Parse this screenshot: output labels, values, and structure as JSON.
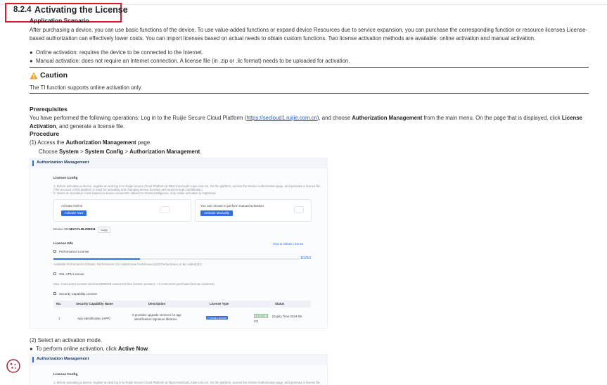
{
  "section": {
    "number": "8.2.4",
    "title": "Activating the License"
  },
  "scenario": {
    "heading": "Application Scenario",
    "paragraph": "After purchasing a device, you can use basic functions of the device. To use value-added functions or expand device Resources due to service expansion, you can purchase the corresponding function or resource licenses License-based authorization can effectively lower costs. You can import licenses based on actual needs to obtain custom functions. Two license activation methods are available: online activation and manual activation.",
    "bullets": [
      "Online activation: requires the device to be connected to the Internet.",
      "Manual activation: does not require an Internet connection. A license file (in .zip or .lic format) needs to be uploaded for activation."
    ]
  },
  "caution": {
    "title": "Caution",
    "text": "The TI function supports online activation only."
  },
  "prerequisites": {
    "heading": "Prerequisites",
    "part1": "You have performed the following operations: Log in to the Ruijie Secure Cloud Platform (",
    "link": "https://secloud1.ruijie.com.cn",
    "part2": "), and choose ",
    "bold1": "Authorization Management",
    "part3": " from the main menu. On the page that is displayed, click ",
    "bold2": "License Activation",
    "part4": ", and generate a license file."
  },
  "procedure": {
    "heading": "Procedure",
    "step1_num": "(1)",
    "step1_text": "Access the ",
    "step1_bold": "Authorization Management",
    "step1_end": " page.",
    "choose": "Choose ",
    "path1": "System",
    "sep": " > ",
    "path2": "System Config",
    "path3": "Authorization Management",
    "period": ".",
    "step2_num": "(2)",
    "step2_text": "Select an activation mode.",
    "bullet3_text": "To perform online activation, click ",
    "bullet3_bold": "Active Now",
    "bullet3_end": "."
  },
  "screenshot1": {
    "header": "Authorization Management",
    "license_config": "License Config",
    "note1": "1. Before activating a device, register an and log in to Ruijie Secure Cloud Platform at https://secloud1.ruijie.com.cn/. On the platform, access the Device Authorization page, and generate a license file.",
    "note2": "(The account of this platform is used for activating and changing device licenses and must be kept confidential.)",
    "note3": "2. Select an activation mode based on device connection status.For threat intelligence, only online activation is supported.",
    "online_label": "Activate Online",
    "online_button": "Activate Now",
    "manual_label": "You can choose to perform manual activation.",
    "manual_button": "Activate Manually",
    "device_sn_label": "Device SN:",
    "device_sn": "MACCLHLZ32511",
    "copy_button": "Copy",
    "license_info": "License Info",
    "how_to": "How to Obtain License",
    "perf_license": "Performance License",
    "perf_value": "1G/5G",
    "perf_note": "Available Performance:1Gbase: Performance:1G+Added New Performance(0G)",
    "perf_note2": "Performance to Be Added(2G)",
    "ssl_license": "SSL VPN License",
    "ssl_note": "Max. Concurrent License Sessions(590/0/8 concurrent free license sessions + 0 concurrent purchased license sessions)",
    "sec_license": "Security Capability License",
    "table_headers": [
      "No.",
      "Security Capability Name",
      "Description",
      "License Type",
      "Status"
    ],
    "table_row": {
      "no": "1",
      "name": "App Identification (APP)",
      "desc1": "It provides upgrade services for app",
      "desc2": "identification signature libraries.",
      "type": "Formal License",
      "status_tag": "Activated",
      "status_text": "(Expiry Time:2024-08-",
      "status_text2": "07)"
    }
  },
  "screenshot2": {
    "header": "Authorization Management",
    "license_config": "License Config",
    "note1": "1. Before activating a device, register an and log in to Ruijie Secure Cloud Platform at https://secloud1.ruijie.com.cn/. On the platform, access the Device Authorization page, and generate a license file."
  },
  "colors": {
    "highlight": "#e0182a",
    "link": "#1a5fb4",
    "primary_button": "#2f6fe0",
    "caution": "#f2a51a"
  },
  "icons": [
    "caution-icon",
    "cookie-icon"
  ]
}
